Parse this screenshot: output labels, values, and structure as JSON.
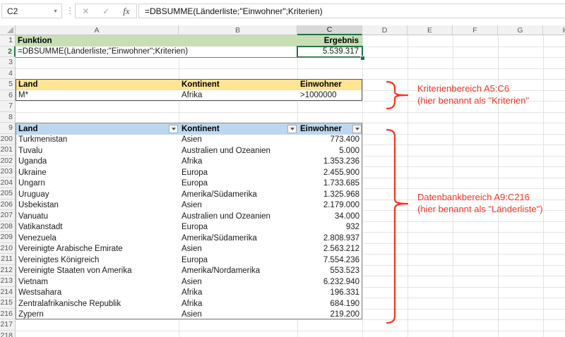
{
  "formula_bar": {
    "name_box": "C2",
    "cancel_icon": "✕",
    "enter_icon": "✓",
    "fx_icon": "fx",
    "formula": "=DBSUMME(Länderliste;\"Einwohner\";Kriterien)"
  },
  "grid": {
    "columns": [
      "A",
      "B",
      "C",
      "D",
      "E",
      "F",
      "G",
      "H"
    ],
    "selected_column": "C",
    "selected_row": "2",
    "row_numbers": [
      "1",
      "2",
      "3",
      "4",
      "5",
      "6",
      "7",
      "8",
      "9",
      "200",
      "201",
      "202",
      "203",
      "204",
      "205",
      "206",
      "207",
      "208",
      "209",
      "210",
      "211",
      "212",
      "213",
      "214",
      "215",
      "216",
      "217",
      "218"
    ]
  },
  "result_block": {
    "function_header": "Funktion",
    "result_header": "Ergebnis",
    "formula_text": "=DBSUMME(Länderliste;\"Einwohner\";Kriterien)",
    "result_value": "5.539.317"
  },
  "criteria_block": {
    "headers": [
      "Land",
      "Kontinent",
      "Einwohner"
    ],
    "values": [
      "M*",
      "Afrika",
      ">1000000"
    ]
  },
  "database_block": {
    "headers": [
      "Land",
      "Kontinent",
      "Einwohner"
    ],
    "rows": [
      {
        "land": "Turkmenistan",
        "kontinent": "Asien",
        "einwohner": "773.400"
      },
      {
        "land": "Tuvalu",
        "kontinent": "Australien und Ozeanien",
        "einwohner": "5.000"
      },
      {
        "land": "Uganda",
        "kontinent": "Afrika",
        "einwohner": "1.353.236"
      },
      {
        "land": "Ukraine",
        "kontinent": "Europa",
        "einwohner": "2.455.900"
      },
      {
        "land": "Ungarn",
        "kontinent": "Europa",
        "einwohner": "1.733.685"
      },
      {
        "land": "Uruguay",
        "kontinent": "Amerika/Südamerika",
        "einwohner": "1.325.968"
      },
      {
        "land": "Usbekistan",
        "kontinent": "Asien",
        "einwohner": "2.179.000"
      },
      {
        "land": "Vanuatu",
        "kontinent": "Australien und Ozeanien",
        "einwohner": "34.000"
      },
      {
        "land": "Vatikanstadt",
        "kontinent": "Europa",
        "einwohner": "932"
      },
      {
        "land": "Venezuela",
        "kontinent": "Amerika/Südamerika",
        "einwohner": "2.808.937"
      },
      {
        "land": "Vereinigte Arabische Emirate",
        "kontinent": "Asien",
        "einwohner": "2.563.212"
      },
      {
        "land": "Vereinigtes Königreich",
        "kontinent": "Europa",
        "einwohner": "7.554.236"
      },
      {
        "land": "Vereinigte Staaten von Amerika",
        "kontinent": "Amerika/Nordamerika",
        "einwohner": "553.523"
      },
      {
        "land": "Vietnam",
        "kontinent": "Asien",
        "einwohner": "6.232.940"
      },
      {
        "land": "Westsahara",
        "kontinent": "Afrika",
        "einwohner": "196.331"
      },
      {
        "land": "Zentralafrikanische Republik",
        "kontinent": "Afrika",
        "einwohner": "684.190"
      },
      {
        "land": "Zypern",
        "kontinent": "Asien",
        "einwohner": "219.200"
      }
    ]
  },
  "annotations": {
    "criteria_note_line1": "Kriterienbereich A5:C6",
    "criteria_note_line2": "(hier benannt als \"Kriterien\"",
    "database_note_line1": "Datenbankbereich A9:C216",
    "database_note_line2": "(hier benannt als \"Länderliste\")"
  },
  "colors": {
    "header_green": "#C6E0B4",
    "criteria_yellow": "#FFE593",
    "database_blue": "#BDD7EE",
    "selection_green": "#217346",
    "annotation_red": "#F93320"
  }
}
